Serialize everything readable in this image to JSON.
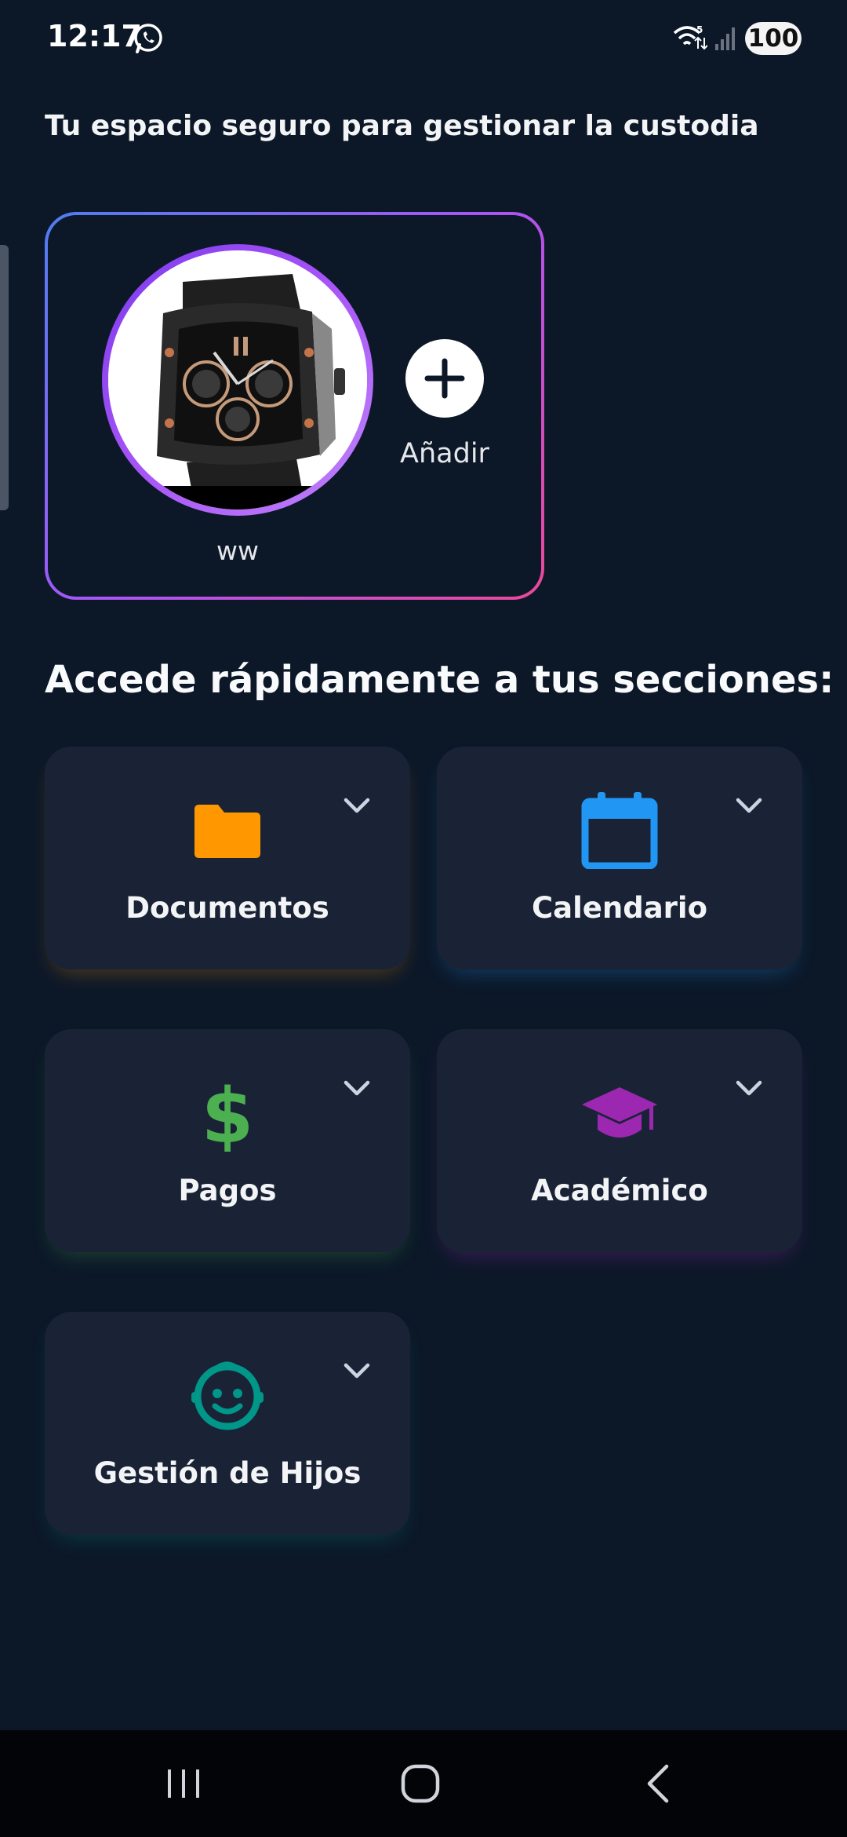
{
  "status_bar": {
    "time": "12:17",
    "battery": "100",
    "icons": [
      "whatsapp-icon",
      "wifi-icon",
      "signal-icon"
    ]
  },
  "header": {
    "subtitle": "Tu espacio seguro para gestionar la custodia"
  },
  "profiles": {
    "items": [
      {
        "name": "ww",
        "avatar": "watch-photo"
      }
    ],
    "add_label": "Añadir"
  },
  "sections": {
    "heading": "Accede rápidamente a tus secciones:",
    "tiles": [
      {
        "label": "Documentos",
        "icon": "folder-icon",
        "color": "#FF9800"
      },
      {
        "label": "Calendario",
        "icon": "calendar-icon",
        "color": "#2196F3"
      },
      {
        "label": "Pagos",
        "icon": "dollar-icon",
        "color": "#4CAF50"
      },
      {
        "label": "Académico",
        "icon": "graduation-cap-icon",
        "color": "#9C27B0"
      },
      {
        "label": "Gestión de Hijos",
        "icon": "child-face-icon",
        "color": "#009688"
      }
    ]
  },
  "colors": {
    "background": "#0c1828",
    "tile": "#1a2336",
    "gradient_start": "#4f7df0",
    "gradient_end": "#ec4899"
  },
  "nav": {
    "icons": [
      "recent-apps-icon",
      "home-icon",
      "back-icon"
    ]
  }
}
